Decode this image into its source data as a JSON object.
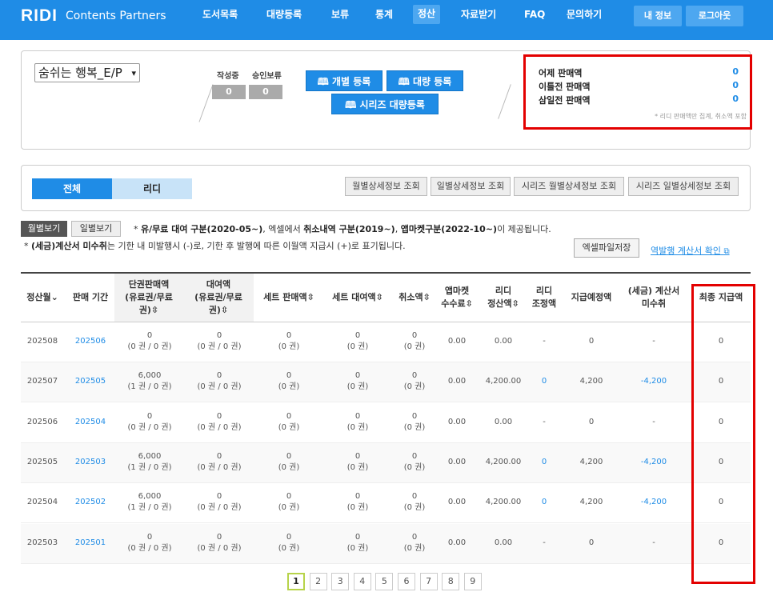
{
  "header": {
    "logo": "RIDI",
    "logo_sub": "Contents Partners",
    "nav": [
      "도서목록",
      "대량등록",
      "보류",
      "통계",
      "정산",
      "자료받기",
      "FAQ",
      "문의하기"
    ],
    "my_info": "내 정보",
    "logout": "로그아웃"
  },
  "book": {
    "selected": "숨쉬는 행복_E/P"
  },
  "counts": {
    "writing_label": "작성중",
    "writing_value": "0",
    "hold_label": "승인보류",
    "hold_value": "0"
  },
  "register": {
    "single": "개별 등록",
    "bulk": "대량 등록",
    "series_bulk": "시리즈 대량등록"
  },
  "sales": {
    "items": [
      {
        "label": "어제 판매액",
        "value": "0"
      },
      {
        "label": "이틀전 판매액",
        "value": "0"
      },
      {
        "label": "삼일전 판매액",
        "value": "0"
      }
    ],
    "note": "* 리디 판매액만 집계, 취소액 포함"
  },
  "tabs": {
    "all": "전체",
    "ridi": "리디"
  },
  "detail_buttons": [
    "월별상세정보 조회",
    "일별상세정보 조회",
    "시리즈 월별상세정보 조회",
    "시리즈 일별상세정보 조회"
  ],
  "view": {
    "monthly": "월별보기",
    "daily": "일별보기"
  },
  "notes": {
    "n1a": "* ",
    "n1b": "유/무료 대여 구분(2020-05~)",
    "n1c": ", 엑셀에서 ",
    "n1d": "취소내역 구분(2019~)",
    "n1e": ", ",
    "n1f": "앱마켓구분(2022-10~)",
    "n1g": "이 제공됩니다.",
    "n2a": "* ",
    "n2b": "(세금)계산서 미수취",
    "n2c": "는 기한 내 미발행시 (-)로, 기한 후 발행에 따른 이월액 지급시 (+)로 표기됩니다."
  },
  "excel": "엑셀파일저장",
  "invoice_link": "역발행 계산서 확인",
  "table": {
    "headers": {
      "month": "정산월",
      "period": "판매 기간",
      "single_1": "단권판매액",
      "single_2": "(유료권/무료",
      "single_3": "권)",
      "rent_1": "대여액",
      "rent_2": "(유료권/무료",
      "rent_3": "권)",
      "set_sale": "세트 판매액",
      "set_rent": "세트 대여액",
      "cancel": "취소액",
      "app_1": "앱마켓",
      "app_2": "수수료",
      "ridi_settle_1": "리디",
      "ridi_settle_2": "정산액",
      "ridi_adj_1": "리디",
      "ridi_adj_2": "조정액",
      "planned": "지급예정액",
      "tax_1": "(세금) 계산서",
      "tax_2": "미수취",
      "final": "최종 지급액"
    },
    "rows": [
      {
        "month": "202508",
        "period": "202506",
        "single": "0",
        "single_sub": "(0 권 / 0 권)",
        "rent": "0",
        "rent_sub": "(0 권 / 0 권)",
        "set_sale": "0",
        "set_sale_sub": "(0 권)",
        "set_rent": "0",
        "set_rent_sub": "(0 권)",
        "cancel": "0",
        "cancel_sub": "(0 권)",
        "app": "0.00",
        "settle": "0.00",
        "adj": "-",
        "planned": "0",
        "tax": "-",
        "final": "0"
      },
      {
        "month": "202507",
        "period": "202505",
        "single": "6,000",
        "single_sub": "(1 권 / 0 권)",
        "rent": "0",
        "rent_sub": "(0 권 / 0 권)",
        "set_sale": "0",
        "set_sale_sub": "(0 권)",
        "set_rent": "0",
        "set_rent_sub": "(0 권)",
        "cancel": "0",
        "cancel_sub": "(0 권)",
        "app": "0.00",
        "settle": "4,200.00",
        "adj": "0",
        "planned": "4,200",
        "tax": "-4,200",
        "final": "0"
      },
      {
        "month": "202506",
        "period": "202504",
        "single": "0",
        "single_sub": "(0 권 / 0 권)",
        "rent": "0",
        "rent_sub": "(0 권 / 0 권)",
        "set_sale": "0",
        "set_sale_sub": "(0 권)",
        "set_rent": "0",
        "set_rent_sub": "(0 권)",
        "cancel": "0",
        "cancel_sub": "(0 권)",
        "app": "0.00",
        "settle": "0.00",
        "adj": "-",
        "planned": "0",
        "tax": "-",
        "final": "0"
      },
      {
        "month": "202505",
        "period": "202503",
        "single": "6,000",
        "single_sub": "(1 권 / 0 권)",
        "rent": "0",
        "rent_sub": "(0 권 / 0 권)",
        "set_sale": "0",
        "set_sale_sub": "(0 권)",
        "set_rent": "0",
        "set_rent_sub": "(0 권)",
        "cancel": "0",
        "cancel_sub": "(0 권)",
        "app": "0.00",
        "settle": "4,200.00",
        "adj": "0",
        "planned": "4,200",
        "tax": "-4,200",
        "final": "0"
      },
      {
        "month": "202504",
        "period": "202502",
        "single": "6,000",
        "single_sub": "(1 권 / 0 권)",
        "rent": "0",
        "rent_sub": "(0 권 / 0 권)",
        "set_sale": "0",
        "set_sale_sub": "(0 권)",
        "set_rent": "0",
        "set_rent_sub": "(0 권)",
        "cancel": "0",
        "cancel_sub": "(0 권)",
        "app": "0.00",
        "settle": "4,200.00",
        "adj": "0",
        "planned": "4,200",
        "tax": "-4,200",
        "final": "0"
      },
      {
        "month": "202503",
        "period": "202501",
        "single": "0",
        "single_sub": "(0 권 / 0 권)",
        "rent": "0",
        "rent_sub": "(0 권 / 0 권)",
        "set_sale": "0",
        "set_sale_sub": "(0 권)",
        "set_rent": "0",
        "set_rent_sub": "(0 권)",
        "cancel": "0",
        "cancel_sub": "(0 권)",
        "app": "0.00",
        "settle": "0.00",
        "adj": "-",
        "planned": "0",
        "tax": "-",
        "final": "0"
      }
    ]
  },
  "pagination": [
    "1",
    "2",
    "3",
    "4",
    "5",
    "6",
    "7",
    "8",
    "9"
  ],
  "colors": {
    "brand": "#1f8ce6",
    "highlight": "#e30000",
    "tab_inactive": "#c8e3f8"
  }
}
